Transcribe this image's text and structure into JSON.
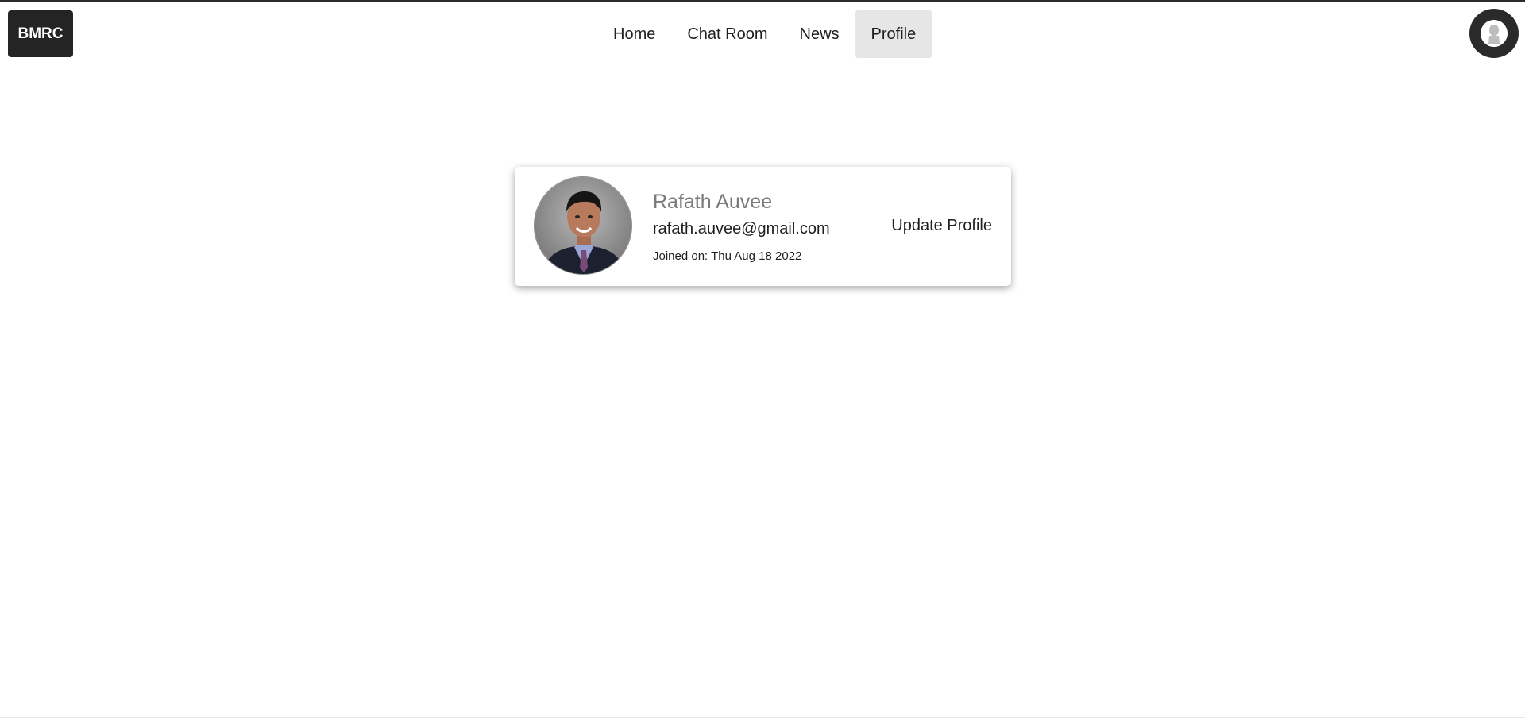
{
  "brand": {
    "label": "BMRC"
  },
  "nav": {
    "items": [
      {
        "label": "Home",
        "active": false
      },
      {
        "label": "Chat Room",
        "active": false
      },
      {
        "label": "News",
        "active": false
      },
      {
        "label": "Profile",
        "active": true
      }
    ]
  },
  "user_menu": {
    "icon": "user-avatar-icon"
  },
  "profile": {
    "name": "Rafath Auvee",
    "email": "rafath.auvee@gmail.com",
    "joined": "Joined on: Thu Aug 18 2022",
    "update_label": "Update Profile",
    "photo_icon": "profile-photo"
  },
  "colors": {
    "brand_bg": "#242424",
    "active_tab_bg": "#e6e6e6",
    "name_text": "#7a7a7a"
  }
}
